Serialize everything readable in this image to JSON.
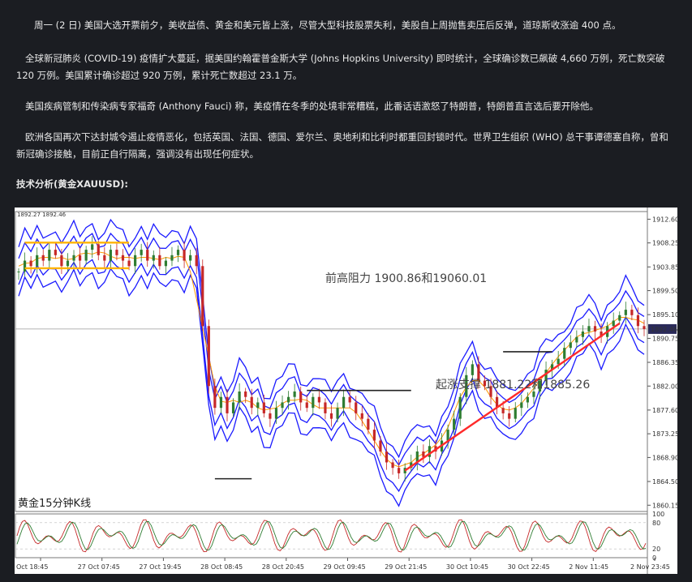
{
  "article": {
    "p1": "周一 (2 日) 美国大选开票前夕，美收益债、黄金和美元皆上涨，尽管大型科技股票失利，美股自上周抛售卖压后反弹，道琼斯收涨逾 400 点。",
    "p2": "全球新冠肺炎 (COVID-19) 疫情扩大蔓延，据美国约翰霍普金斯大学 (Johns Hopkins University) 即时统计，全球确诊数已飙破 4,660 万例，死亡数突破 120 万例。美国累计确诊超过 920 万例，累计死亡数超过 23.1 万。",
    "p3": "美国疾病管制和传染病专家福奇 (Anthony Fauci) 称，美疫情在冬季的处境非常糟糕，此番话语激怒了特朗普，特朗普直言选后要开除他。",
    "p4": "欧洲各国再次下达封城令遏止疫情恶化，包括英国、法国、德国、爱尔兰、奥地利和比利时都重回封锁时代。世界卫生组织 (WHO) 总干事谭德塞自称，曾和新冠确诊接触，目前正自行隔离，强调没有出现任何症状。",
    "heading": "技术分析(黄金XAUUSD):"
  },
  "chart_meta": {
    "ohlc_label": "1892.27 1892.46",
    "panel_title": "黄金15分钟K线",
    "resistance_label": "前高阻力 1900.86和19060.01",
    "support_label": "起涨支撑 1881.22和1885.26",
    "current_price": "1892.46",
    "colors": {
      "band": "#1a1aff",
      "trend": "#ff2a2a",
      "up": "#2e7d32",
      "down": "#c62828",
      "ma": "#ff9800",
      "grid": "#999999",
      "hline": "#ffb300"
    }
  },
  "chart_data": [
    {
      "type": "line",
      "title": "",
      "y_ticks": [
        "1912.60",
        "1908.25",
        "1903.85",
        "1899.50",
        "1895.10",
        "1890.75",
        "1886.35",
        "1882.00",
        "1877.60",
        "1873.25",
        "1868.90",
        "1864.50",
        "1860.15"
      ],
      "ylim": [
        1859,
        1914
      ],
      "x_ticks": [
        "Oct 18:45",
        "27 Oct 07:45",
        "27 Oct 19:45",
        "28 Oct 08:45",
        "28 Oct 20:45",
        "29 Oct 09:45",
        "29 Oct 21:45",
        "30 Oct 10:45",
        "30 Oct 22:45",
        "2 Nov 11:45",
        "2 Nov 23:45"
      ],
      "series": [
        {
          "values": [
            1903,
            1905,
            1904,
            1906,
            1905,
            1907,
            1906,
            1904,
            1905,
            1906,
            1905,
            1907,
            1908,
            1906,
            1905,
            1907,
            1906,
            1905,
            1904,
            1906,
            1907,
            1905,
            1906,
            1904,
            1905,
            1906,
            1907,
            1905,
            1906,
            1904,
            1893,
            1882,
            1878,
            1880,
            1877,
            1879,
            1881,
            1880,
            1878,
            1879,
            1877,
            1876,
            1878,
            1879,
            1880,
            1881,
            1879,
            1878,
            1880,
            1879,
            1877,
            1876,
            1878,
            1880,
            1879,
            1877,
            1876,
            1874,
            1872,
            1870,
            1868,
            1867,
            1866,
            1867,
            1868,
            1870,
            1869,
            1871,
            1870,
            1872,
            1874,
            1876,
            1880,
            1884,
            1886,
            1883,
            1882,
            1880,
            1878,
            1877,
            1876,
            1878,
            1879,
            1880,
            1881,
            1883,
            1885,
            1886,
            1887,
            1889,
            1890,
            1891,
            1892,
            1893,
            1892,
            1891,
            1893,
            1894,
            1895,
            1896,
            1895,
            1893,
            1892.46
          ]
        }
      ],
      "trend_line": [
        [
          1866.5,
          1893.5
        ]
      ],
      "support_segments": [
        1865.0,
        1881.2,
        1888.3
      ],
      "resistance_levels": [
        1908.3,
        1903.6
      ],
      "indicator_ylim": [
        0,
        100
      ],
      "indicator_ticks": [
        "100",
        "80",
        "20",
        "0"
      ]
    }
  ]
}
